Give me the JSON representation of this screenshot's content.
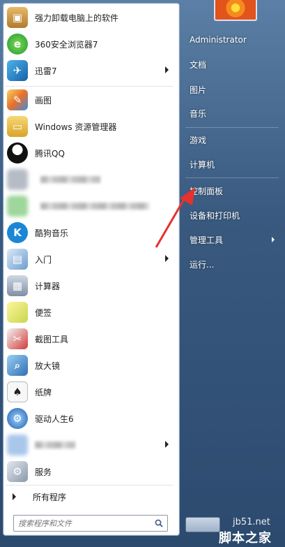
{
  "left_panel": {
    "items": [
      {
        "label": "强力卸载电脑上的软件",
        "icon": "uninstall-box-icon",
        "has_arrow": false
      },
      {
        "label": "360安全浏览器7",
        "icon": "browser-360-icon",
        "has_arrow": false
      },
      {
        "label": "迅雷7",
        "icon": "xunlei-bird-icon",
        "has_arrow": true
      },
      {
        "label": "画图",
        "icon": "paint-palette-icon",
        "has_arrow": false
      },
      {
        "label": "Windows 资源管理器",
        "icon": "explorer-folder-icon",
        "has_arrow": false
      },
      {
        "label": "腾讯QQ",
        "icon": "qq-penguin-icon",
        "has_arrow": false
      },
      {
        "label": "",
        "icon": "blurred-app-icon",
        "has_arrow": false
      },
      {
        "label": "",
        "icon": "blurred-app-icon",
        "has_arrow": false
      },
      {
        "label": "酷狗音乐",
        "icon": "kugou-icon",
        "has_arrow": false
      },
      {
        "label": "入门",
        "icon": "getting-started-icon",
        "has_arrow": true
      },
      {
        "label": "计算器",
        "icon": "calculator-icon",
        "has_arrow": false
      },
      {
        "label": "便签",
        "icon": "sticky-notes-icon",
        "has_arrow": false
      },
      {
        "label": "截图工具",
        "icon": "snipping-tool-icon",
        "has_arrow": false
      },
      {
        "label": "放大镜",
        "icon": "magnifier-icon",
        "has_arrow": false
      },
      {
        "label": "纸牌",
        "icon": "solitaire-card-icon",
        "has_arrow": false
      },
      {
        "label": "驱动人生6",
        "icon": "driver-gear-icon",
        "has_arrow": false
      },
      {
        "label": "",
        "icon": "blurred-app-icon",
        "has_arrow": true
      },
      {
        "label": "服务",
        "icon": "services-gears-icon",
        "has_arrow": false
      }
    ],
    "all_programs": "所有程序",
    "search_placeholder": "搜索程序和文件"
  },
  "right_panel": {
    "user": "Administrator",
    "items": [
      {
        "label": "文档"
      },
      {
        "label": "图片"
      },
      {
        "label": "音乐"
      },
      {
        "label": "游戏"
      },
      {
        "label": "计算机"
      },
      {
        "label": "控制面板"
      },
      {
        "label": "设备和打印机"
      },
      {
        "label": "管理工具"
      },
      {
        "label": "运行..."
      }
    ]
  },
  "watermark": {
    "site": "jb51.net",
    "name": "脚本之家"
  },
  "colors": {
    "accent_arrow": "#e5322d",
    "panel_border": "#8aa2bf"
  }
}
